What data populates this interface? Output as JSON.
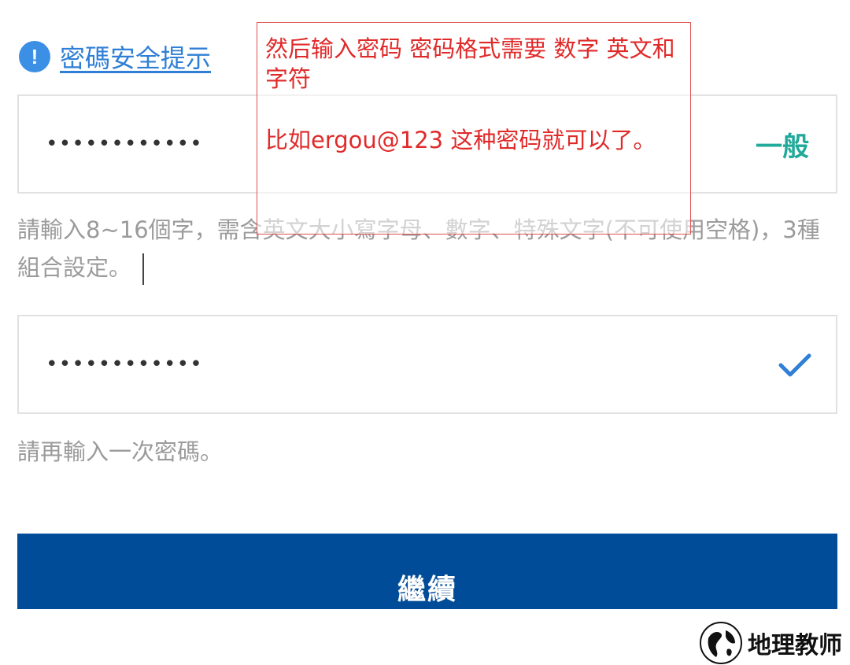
{
  "password_tip": {
    "icon": "exclamation-icon",
    "label": "密碼安全提示"
  },
  "password_field": {
    "masked_value": "••••••••••••",
    "strength_label": "一般"
  },
  "password_hint": "請輸入8~16個字，需含英文大小寫字母、數字、特殊文字(不可使用空格)，3種組合設定。",
  "confirm_field": {
    "masked_value": "••••••••••••",
    "status_icon": "checkmark-icon"
  },
  "confirm_hint": "請再輸入一次密碼。",
  "continue_button": {
    "label": "繼續"
  },
  "annotation": {
    "line1": "然后输入密码 密码格式需要 数字 英文和字符",
    "line2": "比如ergou@123 这种密码就可以了。"
  },
  "watermark": {
    "text": "地理教师"
  },
  "colors": {
    "primary": "#004c99",
    "link": "#2f7fd6",
    "strength": "#21a99a",
    "annotation": "#e02a2a",
    "hint": "#9b9b9b"
  }
}
